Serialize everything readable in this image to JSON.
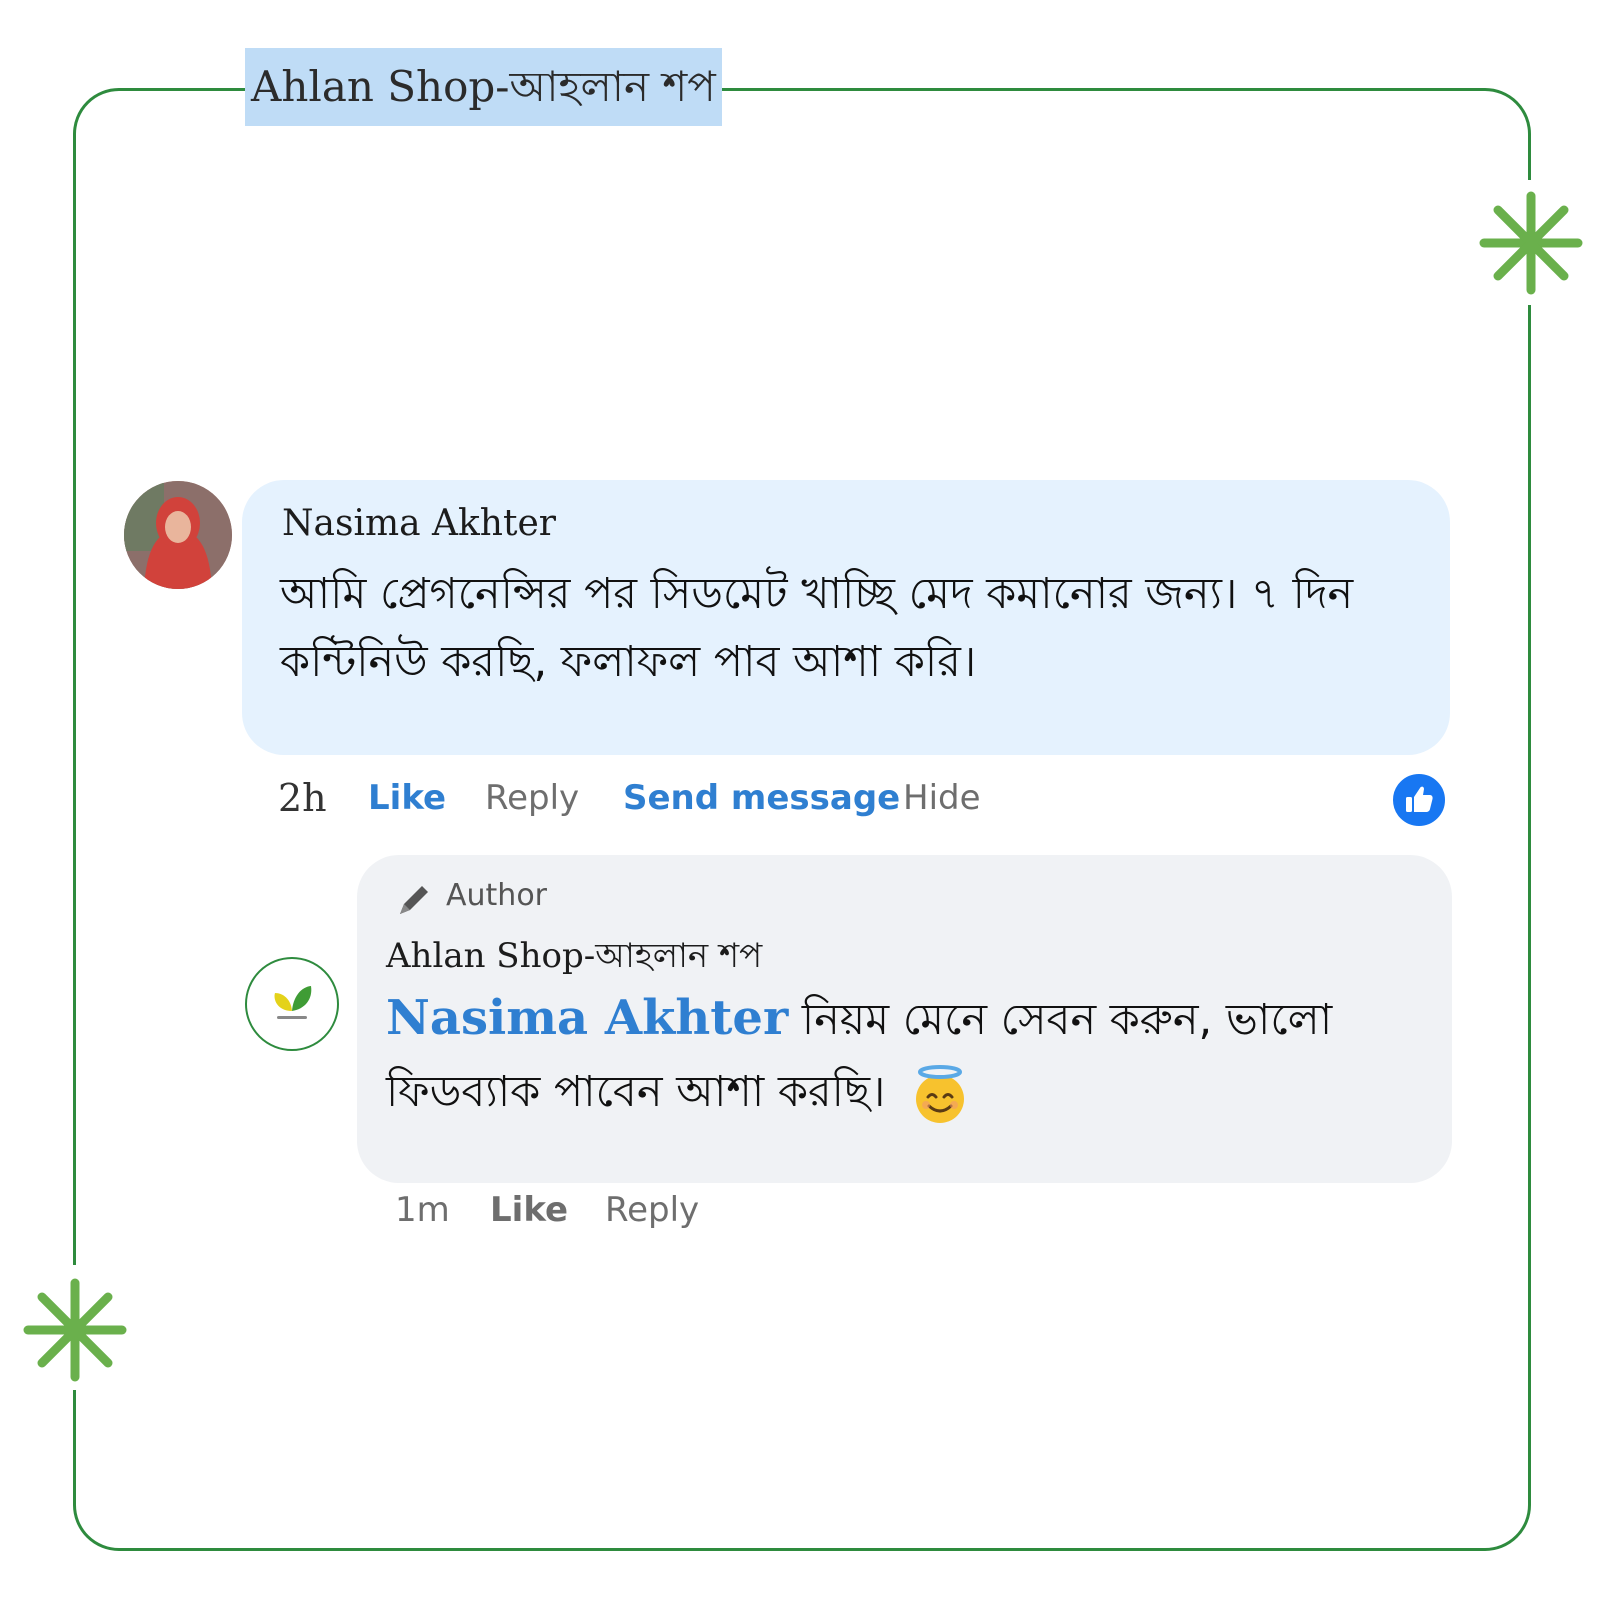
{
  "page": {
    "title": "Ahlan Shop-আহলান শপ",
    "frame_color": "#2e8b3e",
    "accent_star_color": "#6ab04c"
  },
  "comment": {
    "author": "Nasima Akhter",
    "text": "আমি প্রেগনেন্সির পর সিডমেট খাচ্ছি মেদ কমানোর জন্য। ৭ দিন কন্টিনিউ করছি, ফলাফল পাব আশা করি।",
    "time": "2h",
    "actions": {
      "like": "Like",
      "reply": "Reply",
      "send_message": "Send message",
      "hide": "Hide"
    },
    "reaction_icon": "like-thumb-icon"
  },
  "reply": {
    "badge": "Author",
    "badge_icon": "pen-icon",
    "author": "Ahlan Shop-আহলান শপ",
    "mention": "Nasima Akhter",
    "text": "নিয়ম মেনে সেবন করুন, ভালো ফিডব্যাক পাবেন আশা করছি।",
    "emoji": "smiling-face-with-halo-icon",
    "time": "1m",
    "actions": {
      "like": "Like",
      "reply": "Reply"
    }
  }
}
